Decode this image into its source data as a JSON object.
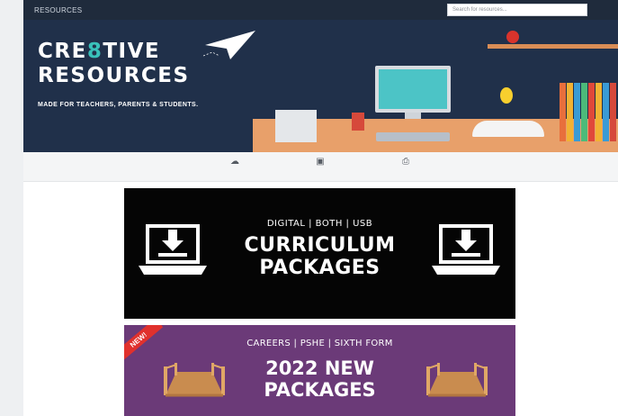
{
  "nav": {
    "brand": "RESOURCES",
    "links": [
      "",
      "",
      "",
      "",
      "",
      ""
    ],
    "search_placeholder": "Search for resources..."
  },
  "hero": {
    "title_line1_a": "CRE",
    "title_line1_b": "8",
    "title_line1_c": "TIVE",
    "title_line2": "RESOURCES",
    "tagline": "MADE FOR TEACHERS, PARENTS & STUDENTS.",
    "screen_text": "",
    "colors": {
      "background": "#20304a",
      "accent": "#39c0ba",
      "desk": "#e8a06a"
    }
  },
  "icon_row": [
    {
      "icon": "cloud-download-icon",
      "label": ""
    },
    {
      "icon": "usb-icon",
      "label": ""
    },
    {
      "icon": "printer-icon",
      "label": ""
    }
  ],
  "banner_curriculum": {
    "subtitle": "DIGITAL | BOTH | USB",
    "title_line1": "CURRICULUM",
    "title_line2": "PACKAGES",
    "icon": "laptop-download-icon",
    "color": "#050505"
  },
  "banner_new": {
    "badge": "NEW!",
    "subtitle": "CAREERS | PSHE | SIXTH FORM",
    "title_line1": "2022 NEW",
    "title_line2": "PACKAGES",
    "icon": "bridge-icon",
    "color": "#6b3a78"
  }
}
